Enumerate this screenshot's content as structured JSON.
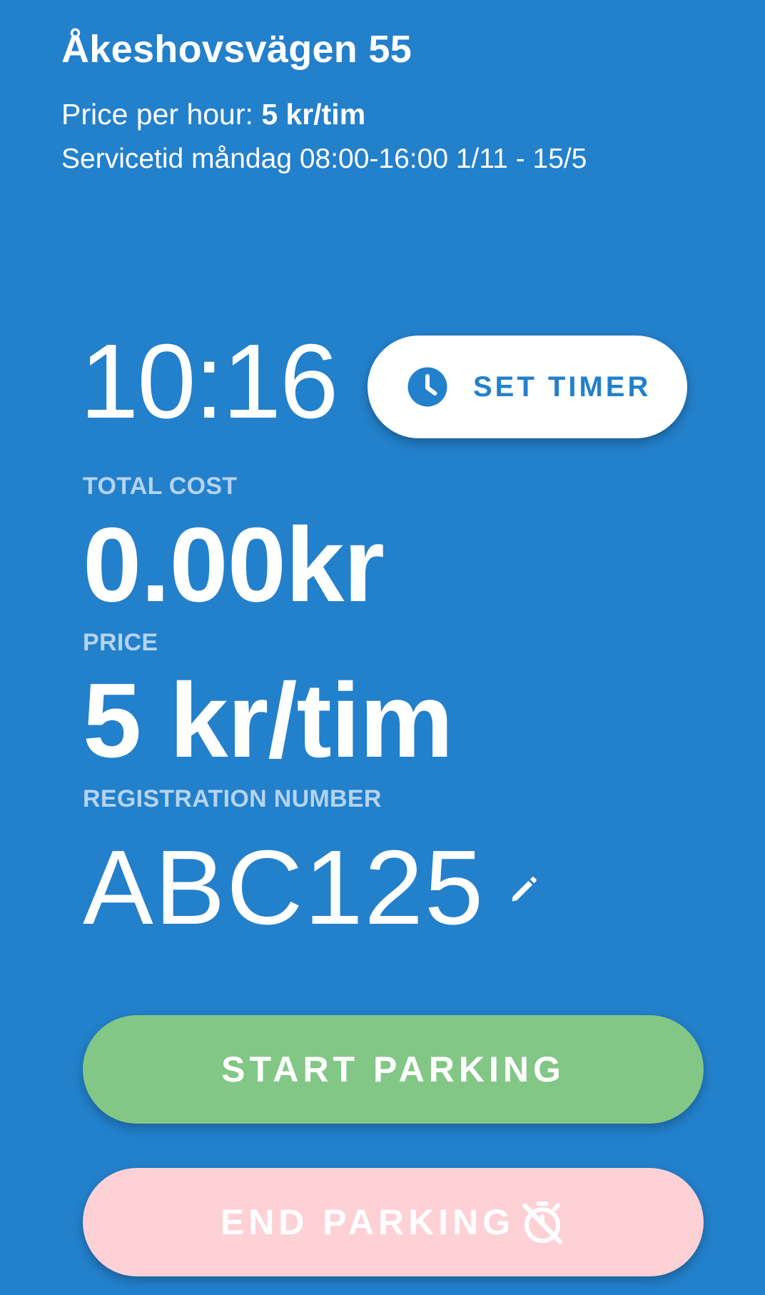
{
  "header": {
    "location_title": "Åkeshovsvägen 55",
    "price_per_hour_label": "Price per hour:",
    "price_per_hour_value": "5 kr/tim",
    "service_time": "Servicetid måndag 08:00-16:00 1/11 - 15/5"
  },
  "timer": {
    "time": "10:16",
    "set_timer_label": "SET TIMER",
    "icon": "clock-icon"
  },
  "total_cost": {
    "label": "TOTAL COST",
    "value": "0.00kr"
  },
  "price": {
    "label": "PRICE",
    "value": "5 kr/tim"
  },
  "registration": {
    "label": "REGISTRATION NUMBER",
    "value": "ABC125",
    "edit_icon": "pencil-icon"
  },
  "actions": {
    "start_label": "START PARKING",
    "end_label": "END PARKING",
    "end_icon": "timer-off-icon"
  },
  "colors": {
    "background": "#2380CB",
    "start_button": "#82C785",
    "end_button": "#FDD1D6",
    "label_text": "#B4D4F0"
  }
}
